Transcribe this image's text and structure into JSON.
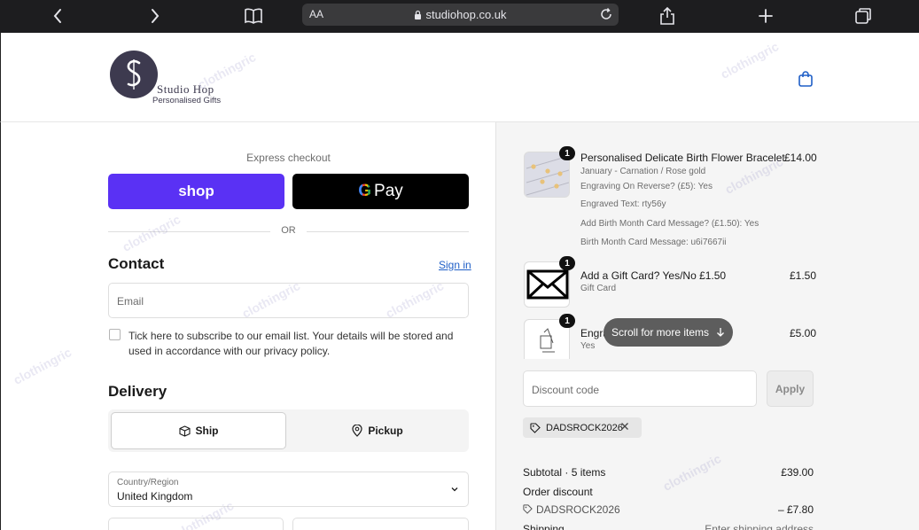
{
  "browser": {
    "text_size_label": "AA",
    "url": "studiohop.co.uk"
  },
  "store": {
    "name": "Studio Hop",
    "tagline": "Personalised Gifts"
  },
  "express": {
    "label": "Express checkout",
    "shop_label": "shop",
    "gpay_g": "G",
    "gpay_label": "Pay",
    "or_label": "OR"
  },
  "contact": {
    "heading": "Contact",
    "sign_in": "Sign in",
    "email_placeholder": "Email",
    "subscribe_text": "Tick here to subscribe to our email list. Your details will be stored and used in accordance with our privacy policy."
  },
  "delivery": {
    "heading": "Delivery",
    "ship_label": "Ship",
    "pickup_label": "Pickup",
    "country_label": "Country/Region",
    "country_value": "United Kingdom"
  },
  "cart": {
    "items": [
      {
        "qty": "1",
        "title": "Personalised Delicate Birth Flower Bracelet",
        "price": "£14.00",
        "details": [
          "January - Carnation / Rose gold",
          "Engraving On Reverse? (£5): Yes",
          "Engraved Text: rty56y",
          "Add Birth Month Card Message? (£1.50): Yes",
          "Birth Month Card Message: u6i7667ii"
        ]
      },
      {
        "qty": "1",
        "title": "Add a Gift Card? Yes/No £1.50",
        "price": "£1.50",
        "details": [
          "Gift Card"
        ]
      },
      {
        "qty": "1",
        "title": "Engra",
        "price": "£5.00",
        "details": [
          "Yes"
        ]
      }
    ],
    "scroll_hint": "Scroll for more items"
  },
  "discount": {
    "placeholder": "Discount code",
    "apply_label": "Apply",
    "applied_code": "DADSROCK2026"
  },
  "summary": {
    "subtotal_label": "Subtotal · 5 items",
    "subtotal_value": "£39.00",
    "order_discount_label": "Order discount",
    "discount_code": "DADSROCK2026",
    "discount_value": "– £7.80",
    "shipping_label": "Shipping",
    "shipping_value": "Enter shipping address"
  },
  "watermark": "clothingric",
  "colors": {
    "shop_purple": "#5a31f4",
    "link_blue": "#1f5fc7",
    "brand": "#3d3a4f"
  }
}
